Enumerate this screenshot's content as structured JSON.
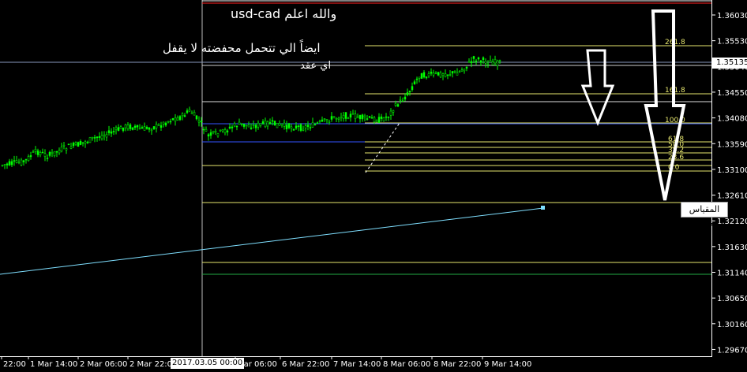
{
  "window": {
    "symbol": "usd-cad"
  },
  "annotations": {
    "line1": "والله اعلم  usd-cad",
    "line2": "ايضاً   الي تتحمل محفضته لا يقفل",
    "line3": "اي عقد"
  },
  "tooltip": {
    "text": "المقياس العمودي"
  },
  "current_price": "1.35135",
  "period_separator_label": "2017.03.05 00:00",
  "price_axis": {
    "ticks": [
      "1.36030",
      "1.35530",
      "1.35040",
      "1.34550",
      "1.34080",
      "1.33590",
      "1.33100",
      "1.32610",
      "1.32120",
      "1.31630",
      "1.31140",
      "1.30650",
      "1.30160",
      "1.29670"
    ]
  },
  "time_axis": {
    "ticks": [
      "22:00",
      "1 Mar 14:00",
      "2 Mar 06:00",
      "2 Mar 22:00",
      "Mar 06:00",
      "6 Mar 22:00",
      "7 Mar 14:00",
      "8 Mar 06:00",
      "8 Mar 22:00",
      "9 Mar 14:00"
    ]
  },
  "fibonacci": {
    "levels": [
      "261.8",
      "161.8",
      "100.0",
      "61.8",
      "50.0",
      "38.2",
      "23.6",
      "0.0"
    ]
  },
  "colors": {
    "background": "#000000",
    "candles": "#00ff00",
    "fib_lines": "#e6e66e",
    "trendline": "#7fdfff",
    "arrows": "#ffffff",
    "blue_line": "#3355ff",
    "top_line": "#ff2020"
  }
}
